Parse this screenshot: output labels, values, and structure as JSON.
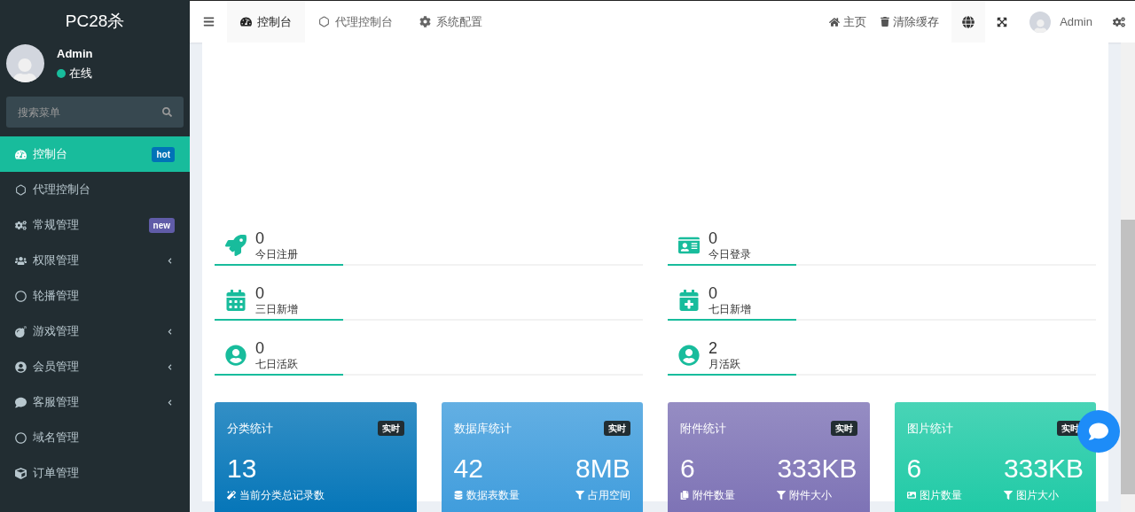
{
  "brand": "PC28杀",
  "user": {
    "name": "Admin",
    "status": "在线",
    "online": true
  },
  "search": {
    "placeholder": "搜索菜单"
  },
  "menu": [
    {
      "label": "控制台",
      "selected": true,
      "badge": "hot",
      "color": "#0073b7",
      "submenu": false
    },
    {
      "label": "代理控制台",
      "selected": false,
      "submenu": false
    },
    {
      "label": "常规管理",
      "selected": false,
      "badge": "new",
      "color": "#605ca8",
      "submenu": false
    },
    {
      "label": "权限管理",
      "selected": false,
      "submenu": true
    },
    {
      "label": "轮播管理",
      "selected": false,
      "submenu": false
    },
    {
      "label": "游戏管理",
      "selected": false,
      "submenu": true
    },
    {
      "label": "会员管理",
      "selected": false,
      "submenu": true
    },
    {
      "label": "客服管理",
      "selected": false,
      "submenu": true
    },
    {
      "label": "域名管理",
      "selected": false,
      "submenu": false
    },
    {
      "label": "订单管理",
      "selected": false,
      "submenu": false
    }
  ],
  "tabs": [
    {
      "label": "控制台",
      "selected": true
    },
    {
      "label": "代理控制台",
      "selected": false
    },
    {
      "label": "系统配置",
      "selected": false
    }
  ],
  "header_links": [
    "主页",
    "清除缓存"
  ],
  "header_user": "Admin",
  "stats": [
    {
      "value": "0",
      "label": "今日注册"
    },
    {
      "value": "0",
      "label": "今日登录"
    },
    {
      "value": "0",
      "label": "三日新增"
    },
    {
      "value": "0",
      "label": "七日新增"
    },
    {
      "value": "0",
      "label": "七日活跃"
    },
    {
      "value": "2",
      "label": "月活跃"
    }
  ],
  "cards": [
    {
      "title": "分类统计",
      "badge": "实时",
      "color": "#0073b7",
      "items": [
        {
          "value": "13",
          "label": "当前分类总记录数"
        }
      ]
    },
    {
      "title": "数据库统计",
      "badge": "实时",
      "color": "#3c9bdc",
      "items": [
        {
          "value": "42",
          "label": "数据表数量"
        },
        {
          "value": "8MB",
          "label": "占用空间"
        }
      ]
    },
    {
      "title": "附件统计",
      "badge": "实时",
      "color": "#7b70b4",
      "items": [
        {
          "value": "6",
          "label": "附件数量"
        },
        {
          "value": "333KB",
          "label": "附件大小"
        }
      ]
    },
    {
      "title": "图片统计",
      "badge": "实时",
      "color": "#1bc9a4",
      "items": [
        {
          "value": "6",
          "label": "图片数量"
        },
        {
          "value": "333KB",
          "label": "图片大小"
        }
      ]
    }
  ]
}
